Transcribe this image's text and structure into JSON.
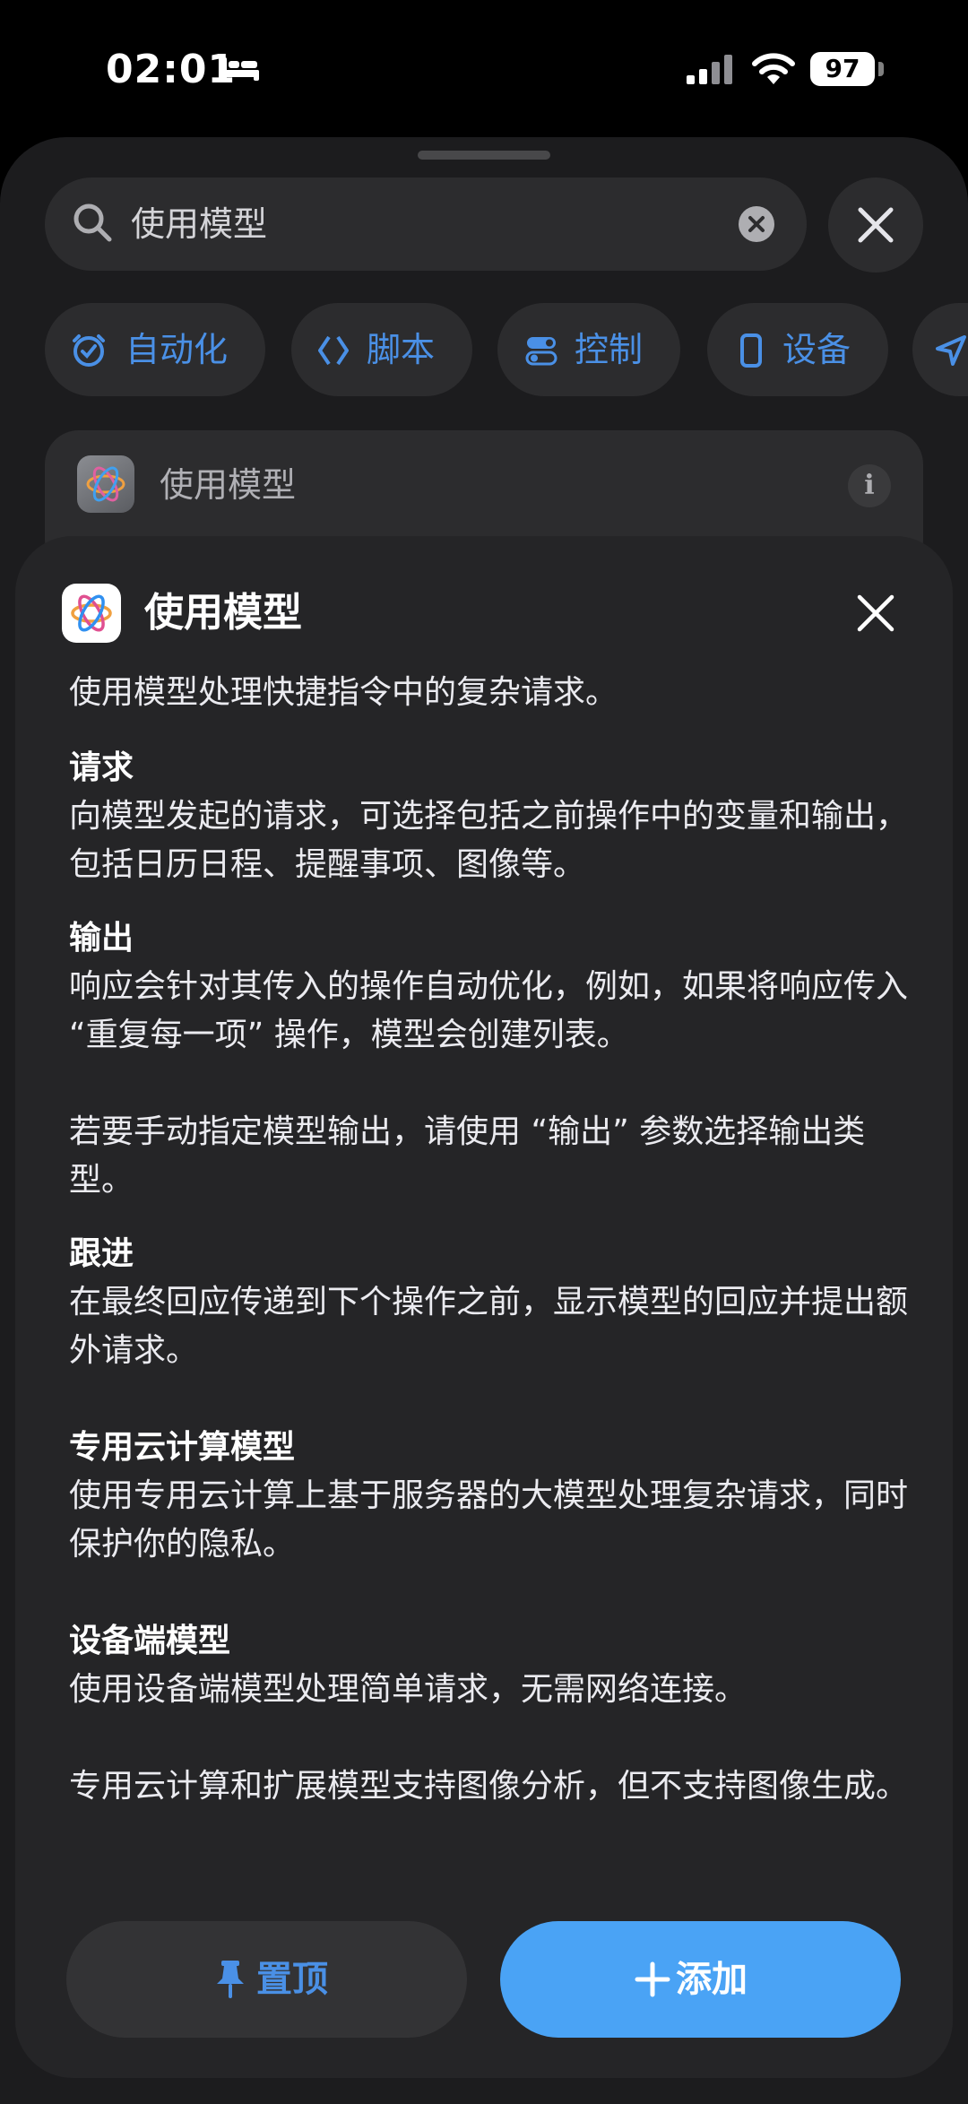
{
  "status_bar": {
    "time": "02:01",
    "battery": "97"
  },
  "search": {
    "query": "使用模型"
  },
  "categories": [
    {
      "label": "自动化",
      "icon": "automation-icon"
    },
    {
      "label": "脚本",
      "icon": "script-icon"
    },
    {
      "label": "控制",
      "icon": "toggle-icon"
    },
    {
      "label": "设备",
      "icon": "phone-icon"
    },
    {
      "label": "",
      "icon": "location-arrow-icon"
    }
  ],
  "result": {
    "label": "使用模型",
    "icon": "apple-intelligence-icon"
  },
  "detail": {
    "title": "使用模型",
    "intro": "使用模型处理快捷指令中的复杂请求。",
    "sections": [
      {
        "title": "请求",
        "text": "向模型发起的请求，可选择包括之前操作中的变量和输出，包括日历日程、提醒事项、图像等。"
      },
      {
        "title": "输出",
        "text": "响应会针对其传入的操作自动优化，例如，如果将响应传入 “重复每一项” 操作，模型会创建列表。",
        "extra": "若要手动指定模型输出，请使用 “输出” 参数选择输出类型。"
      },
      {
        "title": "跟进",
        "text": "在最终回应传递到下个操作之前，显示模型的回应并提出额外请求。"
      },
      {
        "title": "专用云计算模型",
        "text": "使用专用云计算上基于服务器的大模型处理复杂请求，同时保护你的隐私。"
      },
      {
        "title": "设备端模型",
        "text": "使用设备端模型处理简单请求，无需网络连接。",
        "extra": "专用云计算和扩展模型支持图像分析，但不支持图像生成。"
      }
    ],
    "pin_label": "置顶",
    "add_label": "添加"
  },
  "colors": {
    "accent": "#4a90e6",
    "add_button": "#4aa3f5",
    "sheet": "#252527"
  }
}
